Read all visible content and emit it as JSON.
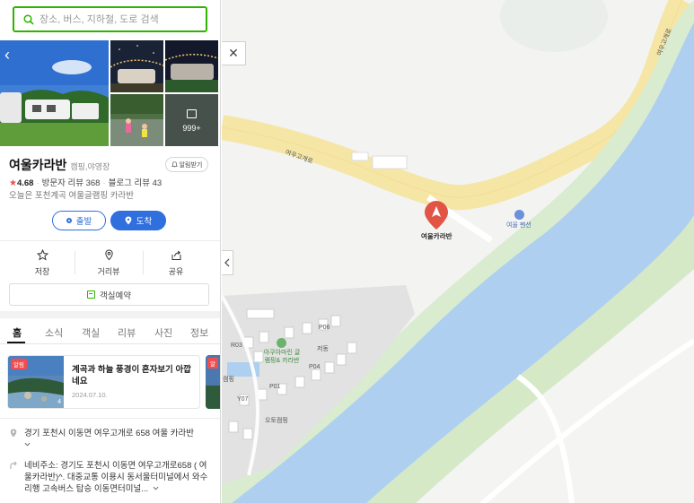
{
  "search": {
    "placeholder": "장소, 버스, 지하철, 도로 검색"
  },
  "photos": {
    "more_count": "999+"
  },
  "place": {
    "name": "여울카라반",
    "category": "캠핑,야영장",
    "alarm_label": "알림받기",
    "rating": "4.68",
    "visitor_reviews": "방문자 리뷰 368",
    "blog_reviews": "블로그 리뷰 43",
    "description": "오늘은 포천계곡 여울글램핑 카라반"
  },
  "directions": {
    "start_label": "출발",
    "arrive_label": "도착"
  },
  "actions": {
    "save_label": "저장",
    "street_view_label": "거리뷰",
    "share_label": "공유"
  },
  "reserve": {
    "label": "객실예약"
  },
  "tabs": [
    {
      "label": "홈"
    },
    {
      "label": "소식"
    },
    {
      "label": "객실"
    },
    {
      "label": "리뷰"
    },
    {
      "label": "사진"
    },
    {
      "label": "정보"
    }
  ],
  "news": {
    "badge": "알림",
    "title": "계곡과 하늘 풍경이 혼자보기 아깝네요",
    "date": "2024.07.10.",
    "photo_count": "4",
    "peek_badge": "알"
  },
  "info": {
    "address": "경기 포천시 이동면 여우고개로 658 여울 카라반",
    "directions_text": "네비주소: 경기도 포천시 이동면 여우고개로658 ( 여울카라반)^. 대중교통 이용시 동서울터미널에서 와수리행 고속버스 탑승 이동면터미널..."
  },
  "map": {
    "pin_label": "여울카라반",
    "road_label": "여우고개로",
    "road_label_2": "여우고개로",
    "lodging_label": "여울 펜션",
    "camp_label": "아쿠아마린 글램핑& 카라반",
    "lot_labels": [
      "R03",
      "P06",
      "저동",
      "P04",
      "P01",
      "Y07",
      "오토캠핑",
      "캠핑"
    ]
  },
  "colors": {
    "brand_green": "#2db400",
    "accent_blue": "#2f6fde",
    "pin_red": "#e25545",
    "river": "#aecff0"
  },
  "icons": [
    "search-icon",
    "back-arrow-icon",
    "bell-icon",
    "star-icon",
    "pin-icon",
    "street-view-icon",
    "share-icon",
    "calendar-icon",
    "close-icon",
    "chevron-left-icon"
  ]
}
